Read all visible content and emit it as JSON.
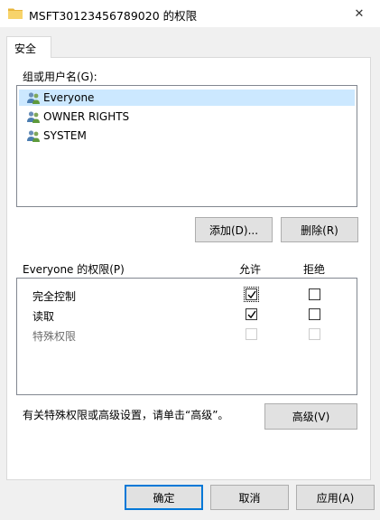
{
  "window": {
    "title": "MSFT30123456789020 的权限",
    "close_glyph": "✕"
  },
  "tabs": [
    {
      "label": "安全",
      "active": true
    }
  ],
  "groups": {
    "label": "组或用户名(G):",
    "items": [
      {
        "name": "Everyone",
        "selected": true
      },
      {
        "name": "OWNER RIGHTS",
        "selected": false
      },
      {
        "name": "SYSTEM",
        "selected": false
      }
    ],
    "add_label": "添加(D)...",
    "remove_label": "删除(R)"
  },
  "permissions": {
    "title": "Everyone 的权限(P)",
    "allow_header": "允许",
    "deny_header": "拒绝",
    "rows": [
      {
        "name": "完全控制",
        "allow": true,
        "deny": false,
        "disabled": false
      },
      {
        "name": "读取",
        "allow": true,
        "deny": false,
        "disabled": false
      },
      {
        "name": "特殊权限",
        "allow": false,
        "deny": false,
        "disabled": true
      }
    ]
  },
  "advanced": {
    "note": "有关特殊权限或高级设置，请单击“高级”。",
    "button_label": "高级(V)"
  },
  "footer": {
    "ok_label": "确定",
    "cancel_label": "取消",
    "apply_label": "应用(A)"
  },
  "colors": {
    "folder": "#f4c542",
    "selection": "#cce8ff",
    "accent": "#0078d7"
  }
}
